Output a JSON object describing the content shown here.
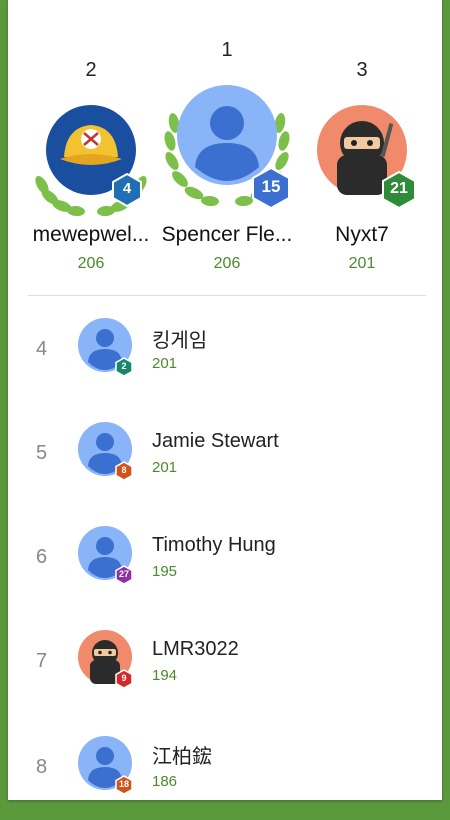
{
  "podium": [
    {
      "rank": "2",
      "name": "mewepwel...",
      "score": "206",
      "level": "4",
      "badge_color": "#1f6fb5",
      "avatar": "baseball-cap-avatar"
    },
    {
      "rank": "1",
      "name": "Spencer Fle...",
      "score": "206",
      "level": "15",
      "badge_color": "#3b6fd0",
      "avatar": "default-person-avatar"
    },
    {
      "rank": "3",
      "name": "Nyxt7",
      "score": "201",
      "level": "21",
      "badge_color": "#2e8b3a",
      "avatar": "ninja-avatar"
    }
  ],
  "rows": [
    {
      "rank": "4",
      "name": "킹게임",
      "score": "201",
      "level": "2",
      "badge_color": "#17876e",
      "avatar": "default-person-avatar"
    },
    {
      "rank": "5",
      "name": "Jamie Stewart",
      "score": "201",
      "level": "8",
      "badge_color": "#d3521a",
      "avatar": "default-person-avatar"
    },
    {
      "rank": "6",
      "name": "Timothy Hung",
      "score": "195",
      "level": "27",
      "badge_color": "#8e2fa3",
      "avatar": "default-person-avatar"
    },
    {
      "rank": "7",
      "name": "LMR3022",
      "score": "194",
      "level": "9",
      "badge_color": "#d02a2a",
      "avatar": "ninja-avatar"
    },
    {
      "rank": "8",
      "name": "江柏鋐",
      "score": "186",
      "level": "18",
      "badge_color": "#d3521a",
      "avatar": "default-person-avatar"
    }
  ]
}
